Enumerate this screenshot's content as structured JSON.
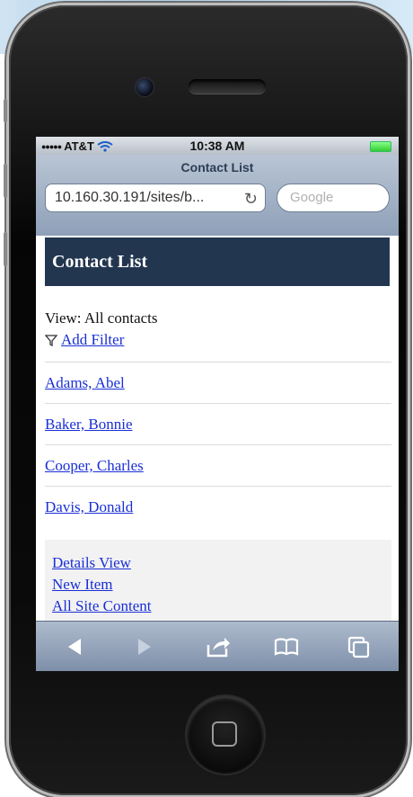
{
  "status_bar": {
    "carrier": "AT&T",
    "time": "10:38 AM"
  },
  "browser": {
    "page_title": "Contact List",
    "url": "10.160.30.191/sites/b...",
    "search_placeholder": "Google"
  },
  "page": {
    "header": "Contact List",
    "view_label": "View: All contacts",
    "add_filter": "Add Filter",
    "contacts": [
      "Adams, Abel",
      "Baker, Bonnie",
      "Cooper, Charles",
      "Davis, Donald"
    ],
    "footer_links": [
      "Details View",
      "New Item",
      "All Site Content"
    ]
  },
  "toolbar": {
    "buttons": [
      "back-icon",
      "forward-icon",
      "share-icon",
      "bookmarks-icon",
      "tabs-icon"
    ]
  },
  "colors": {
    "header_band": "#233650",
    "link": "#1a2fd6",
    "toolbar": "#8ea0b8"
  }
}
